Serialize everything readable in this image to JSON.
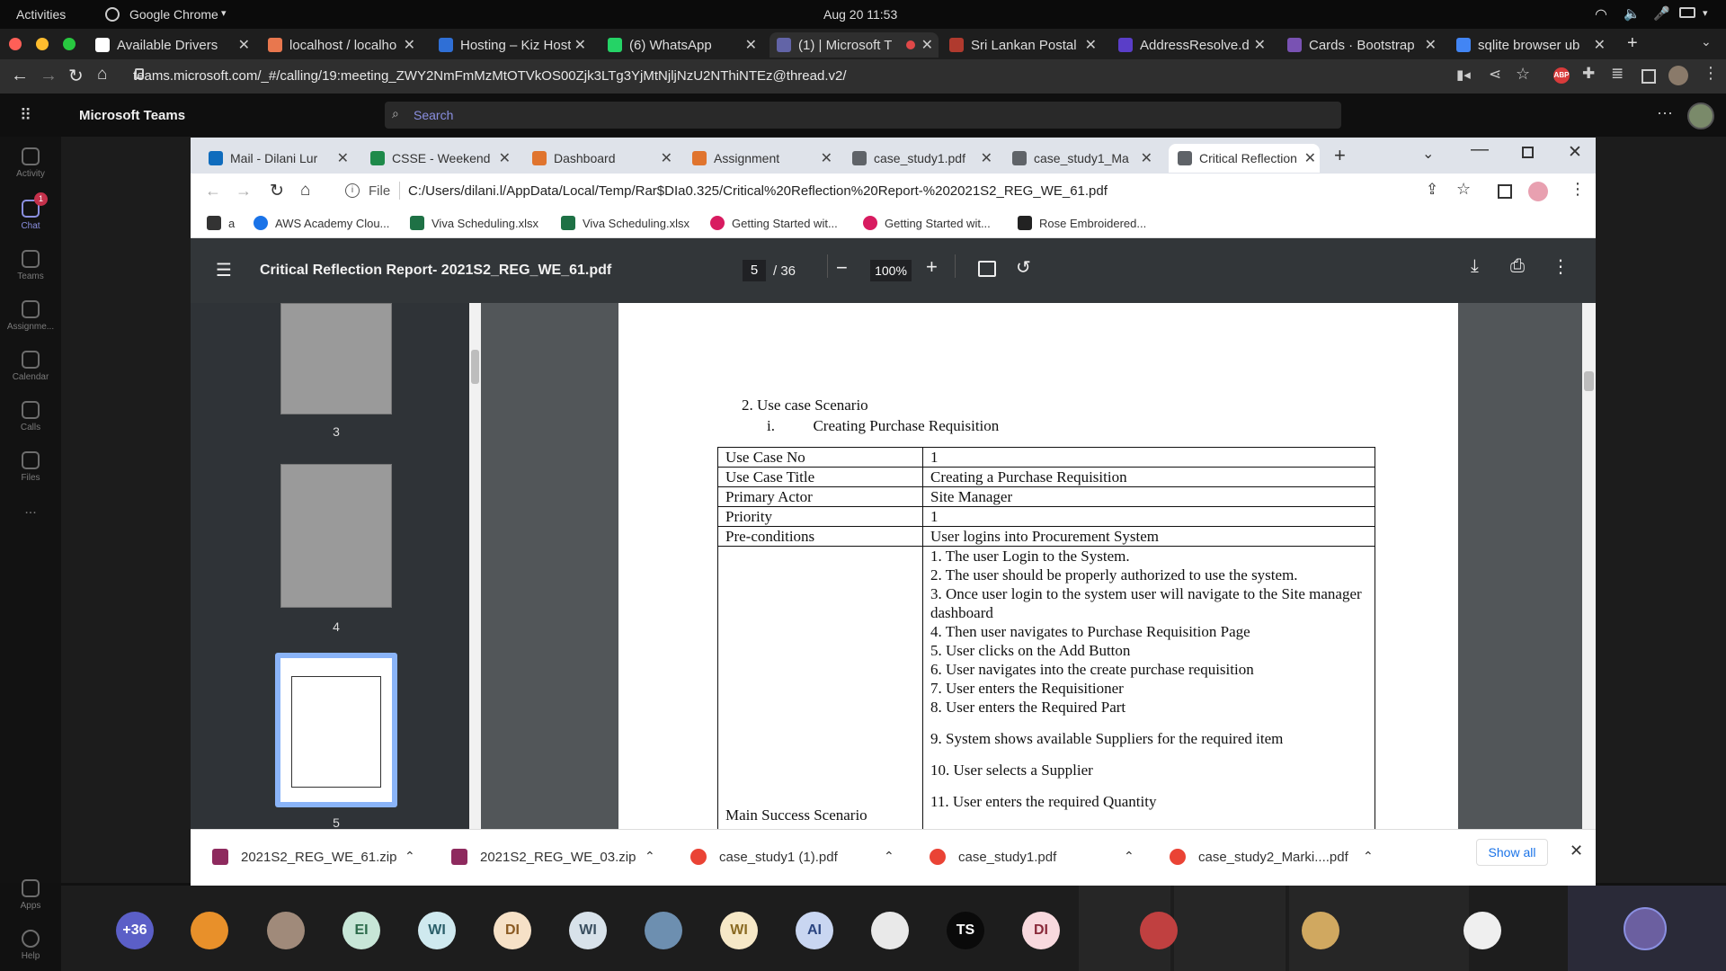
{
  "os": {
    "activities": "Activities",
    "app_menu": "Google Chrome",
    "datetime": "Aug 20  11:53"
  },
  "outer_browser": {
    "tabs": [
      {
        "label": "Available Drivers",
        "color": "#ffffff"
      },
      {
        "label": "localhost / localho",
        "color": "#e8774e"
      },
      {
        "label": "Hosting – Kiz Host",
        "color": "#2f6fd6"
      },
      {
        "label": "(6) WhatsApp",
        "color": "#25d366"
      },
      {
        "label": "(1) | Microsoft T",
        "color": "#6264a7"
      },
      {
        "label": "Sri Lankan Postal",
        "color": "#b03a2e"
      },
      {
        "label": "AddressResolve.d",
        "color": "#5a3ec8"
      },
      {
        "label": "Cards · Bootstrap",
        "color": "#7952b3"
      },
      {
        "label": "sqlite browser ub",
        "color": "#4285f4"
      }
    ],
    "url": "teams.microsoft.com/_#/calling/19:meeting_ZWY2NmFmMzMtOTVkOS00Zjk3LTg3YjMtNjljNzU2NThiNTEz@thread.v2/"
  },
  "teams": {
    "title": "Microsoft Teams",
    "search_placeholder": "Search",
    "rail": [
      {
        "label": "Activity",
        "badge": ""
      },
      {
        "label": "Chat",
        "badge": "1"
      },
      {
        "label": "Teams",
        "badge": ""
      },
      {
        "label": "Assignme...",
        "badge": ""
      },
      {
        "label": "Calendar",
        "badge": ""
      },
      {
        "label": "Calls",
        "badge": ""
      },
      {
        "label": "Files",
        "badge": ""
      },
      {
        "label": "...",
        "badge": ""
      },
      {
        "label": "Apps",
        "badge": ""
      },
      {
        "label": "Help",
        "badge": ""
      }
    ]
  },
  "inner_browser": {
    "tabs": [
      {
        "label": "Mail - Dilani Lur",
        "color": "#0f6cbd"
      },
      {
        "label": "CSSE - Weekend",
        "color": "#1e8a4a"
      },
      {
        "label": "Dashboard",
        "color": "#e0742e"
      },
      {
        "label": "Assignment",
        "color": "#e0742e"
      },
      {
        "label": "case_study1.pdf",
        "color": "#5f6368"
      },
      {
        "label": "case_study1_Ma",
        "color": "#5f6368"
      },
      {
        "label": "Critical Reflection",
        "color": "#5f6368"
      }
    ],
    "file_label": "File",
    "url": "C:/Users/dilani.l/AppData/Local/Temp/Rar$DIa0.325/Critical%20Reflection%20Report-%202021S2_REG_WE_61.pdf",
    "bookmarks": [
      {
        "label": "a",
        "color": "#333333"
      },
      {
        "label": "AWS Academy Clou...",
        "color": "#1a73e8"
      },
      {
        "label": "Viva Scheduling.xlsx",
        "color": "#1e7145"
      },
      {
        "label": "Viva Scheduling.xlsx",
        "color": "#1e7145"
      },
      {
        "label": "Getting Started wit...",
        "color": "#d81b60"
      },
      {
        "label": "Getting Started wit...",
        "color": "#d81b60"
      },
      {
        "label": "Rose Embroidered...",
        "color": "#222222"
      }
    ]
  },
  "pdf": {
    "title": "Critical Reflection Report- 2021S2_REG_WE_61.pdf",
    "page_current": "5",
    "page_total": "/ 36",
    "zoom": "100%",
    "thumbs": [
      "3",
      "4",
      "5"
    ],
    "section_heading": "2.   Use case Scenario",
    "sub_heading": "i.          Creating Purchase Requisition",
    "rows": [
      {
        "label": "Use Case No",
        "value": "1"
      },
      {
        "label": "Use Case Title",
        "value": "Creating a Purchase Requisition"
      },
      {
        "label": "Primary Actor",
        "value": "Site Manager"
      },
      {
        "label": "Priority",
        "value": "1"
      },
      {
        "label": "Pre-conditions",
        "value": "User logins into Procurement System"
      }
    ],
    "main_label": "Main Success Scenario",
    "steps": [
      "1. The user Login to the System.",
      "2. The user should be properly authorized to use the system.",
      "3. Once user login to the system user will navigate to the Site manager dashboard",
      "4. Then user navigates to Purchase Requisition Page",
      "5. User clicks on the Add Button",
      "6. User navigates into the create purchase requisition",
      "7. User enters the Requisitioner",
      "8. User enters the Required Part",
      "9. System shows available Suppliers for the required item",
      "10. User selects a Supplier",
      "11. User enters the required Quantity"
    ]
  },
  "downloads": {
    "items": [
      {
        "label": "2021S2_REG_WE_61.zip",
        "color": "#8e2a5e"
      },
      {
        "label": "2021S2_REG_WE_03.zip",
        "color": "#8e2a5e"
      },
      {
        "label": "case_study1 (1).pdf",
        "color": "#ea4335"
      },
      {
        "label": "case_study1.pdf",
        "color": "#ea4335"
      },
      {
        "label": "case_study2_Marki....pdf",
        "color": "#ea4335"
      }
    ],
    "show_all": "Show all"
  },
  "call": {
    "participants": [
      {
        "initials": "+36",
        "bg": "#5b5fc7",
        "fg": "#ffffff"
      },
      {
        "initials": "",
        "bg": "#e8902a",
        "fg": "#ffffff"
      },
      {
        "initials": "",
        "bg": "#a08a7a",
        "fg": "#ffffff"
      },
      {
        "initials": "EI",
        "bg": "#c7e6d7",
        "fg": "#2b6a4a"
      },
      {
        "initials": "WI",
        "bg": "#cfe9ef",
        "fg": "#2b5f6a"
      },
      {
        "initials": "DI",
        "bg": "#f6e1c7",
        "fg": "#8a5a22"
      },
      {
        "initials": "WI",
        "bg": "#d8e2ea",
        "fg": "#3a4f60"
      },
      {
        "initials": "",
        "bg": "#6d8fb0",
        "fg": "#ffffff"
      },
      {
        "initials": "WI",
        "bg": "#f6e8c7",
        "fg": "#8a6a22"
      },
      {
        "initials": "AI",
        "bg": "#c9d6f1",
        "fg": "#2b4580"
      },
      {
        "initials": "",
        "bg": "#e9e9e9",
        "fg": "#333333"
      },
      {
        "initials": "TS",
        "bg": "#0a0a0a",
        "fg": "#ffffff"
      },
      {
        "initials": "DI",
        "bg": "#f8d9de",
        "fg": "#8a2a3a"
      },
      {
        "initials": "",
        "bg": "#c04040",
        "fg": "#ffffff"
      },
      {
        "initials": "",
        "bg": "#d0a860",
        "fg": "#ffffff"
      },
      {
        "initials": "",
        "bg": "#efefef",
        "fg": "#333333"
      },
      {
        "initials": "",
        "bg": "#6b5fa0",
        "fg": "#ffffff"
      }
    ]
  }
}
